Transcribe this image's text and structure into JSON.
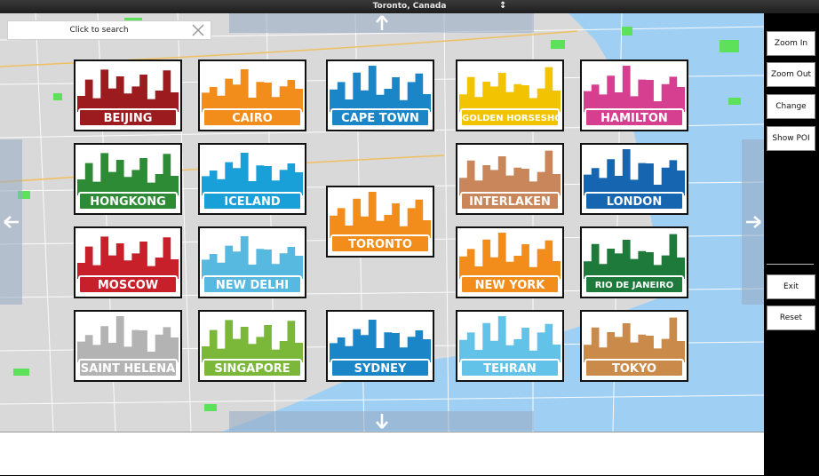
{
  "window": {
    "title": "Toronto, Canada"
  },
  "search": {
    "placeholder": "Click to search"
  },
  "tiles": [
    {
      "label": "BEIJING",
      "color": "#9b1b1f"
    },
    {
      "label": "CAIRO",
      "color": "#f28c1b"
    },
    {
      "label": "CAPE TOWN",
      "color": "#1a86c8"
    },
    {
      "label": "GOLDEN HORSESHOE",
      "color": "#f2c300"
    },
    {
      "label": "HAMILTON",
      "color": "#d63e8f"
    },
    {
      "label": "HONGKONG",
      "color": "#2e8b35"
    },
    {
      "label": "ICELAND",
      "color": "#1aa0d8"
    },
    {
      "label": "TORONTO",
      "color": "#f28c1b"
    },
    {
      "label": "INTERLAKEN",
      "color": "#c8865a"
    },
    {
      "label": "LONDON",
      "color": "#1565b0"
    },
    {
      "label": "MOSCOW",
      "color": "#c8202a"
    },
    {
      "label": "NEW DELHI",
      "color": "#57b9e0"
    },
    {
      "label": "NEW YORK",
      "color": "#f28c1b"
    },
    {
      "label": "RIO DE JANEIRO",
      "color": "#1e7a3a"
    },
    {
      "label": "SAINT HELENA",
      "color": "#b3b3b3"
    },
    {
      "label": "SINGAPORE",
      "color": "#7bb83a"
    },
    {
      "label": "SYDNEY",
      "color": "#1a86c8"
    },
    {
      "label": "TEHRAN",
      "color": "#62c2e8"
    },
    {
      "label": "TOKYO",
      "color": "#c98a4a"
    }
  ],
  "sidebar": {
    "zoom_in": "Zoom In",
    "zoom_out": "Zoom Out",
    "change_map": "Change Map",
    "show_poi": "Show POI",
    "exit": "Exit",
    "reset": "Reset"
  }
}
